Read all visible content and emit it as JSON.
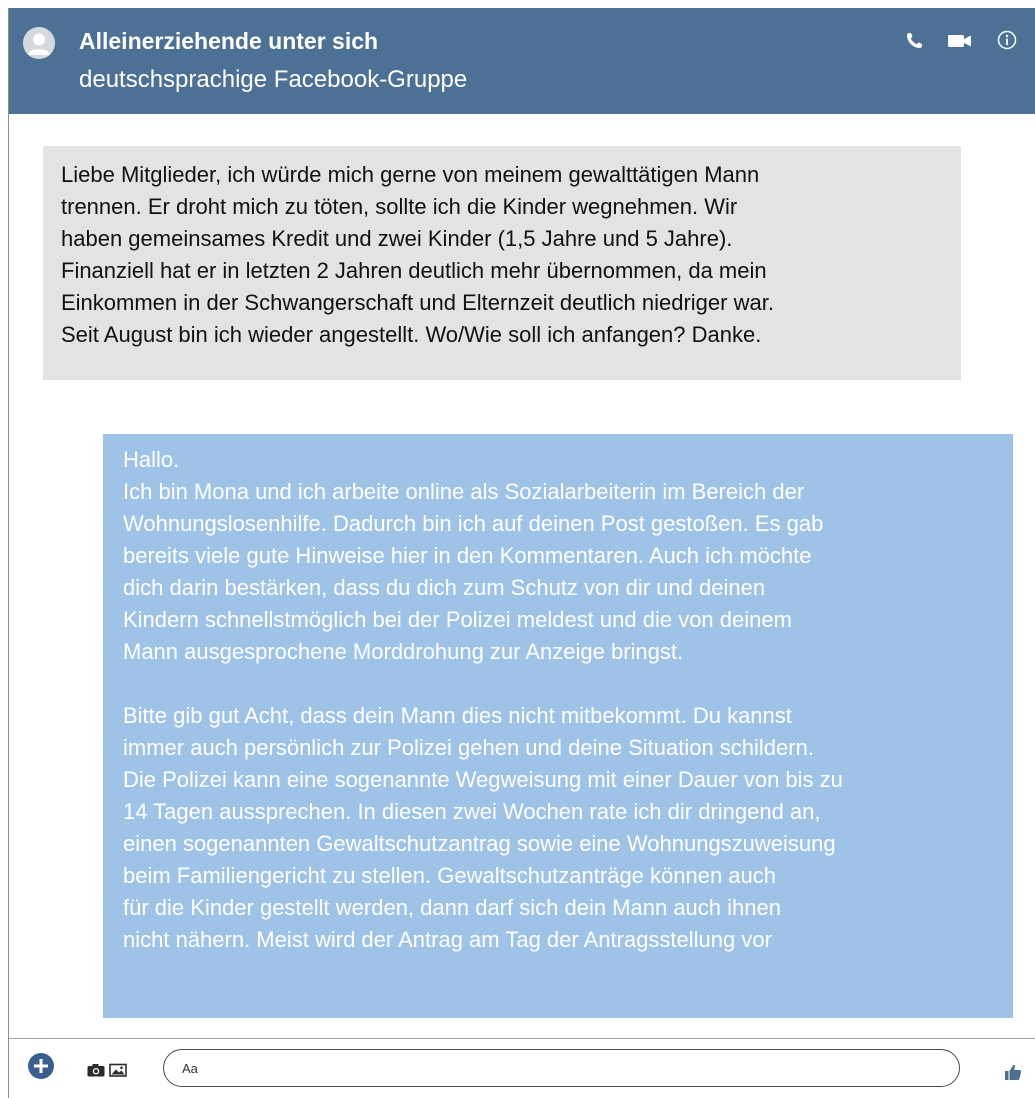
{
  "header": {
    "title": "Alleinerziehende unter sich",
    "subtitle": "deutschsprachige Facebook-Gruppe",
    "icons": [
      "phone-icon",
      "video-camera-icon",
      "info-icon"
    ]
  },
  "messages": {
    "incoming": "Liebe Mitglieder, ich würde mich gerne von meinem gewalttätigen Mann\ntrennen. Er droht mich zu töten, sollte ich die Kinder wegnehmen. Wir\nhaben gemeinsames Kredit und zwei Kinder (1,5 Jahre und 5 Jahre).\nFinanziell hat er in letzten 2 Jahren deutlich mehr übernommen, da mein\nEinkommen in der Schwangerschaft und Elternzeit deutlich niedriger war.\nSeit August bin ich wieder angestellt. Wo/Wie soll ich anfangen? Danke.",
    "outgoing": "Hallo.\nIch bin Mona und ich arbeite online als Sozialarbeiterin im Bereich der\nWohnungslosenhilfe. Dadurch bin ich auf deinen Post gestoßen. Es gab\nbereits viele gute Hinweise hier in den Kommentaren. Auch ich möchte\ndich darin bestärken, dass du dich zum Schutz von dir und deinen\nKindern schnellstmöglich bei der Polizei meldest und die von deinem\nMann ausgesprochene Morddrohung zur Anzeige bringst.\n\nBitte gib gut Acht, dass dein Mann dies nicht mitbekommt. Du kannst\nimmer auch persönlich zur Polizei gehen und deine Situation schildern.\nDie Polizei kann eine sogenannte Wegweisung mit einer Dauer von bis zu\n14 Tagen aussprechen. In diesen zwei Wochen rate ich dir dringend an,\neinen sogenannten Gewaltschutzantrag sowie eine Wohnungszuweisung\nbeim Familiengericht zu stellen. Gewaltschutzanträge können auch\nfür die Kinder gestellt werden, dann darf sich dein Mann auch ihnen\nnicht nähern. Meist wird der Antrag am Tag der Antragsstellung vor"
  },
  "composer": {
    "placeholder": "Aa",
    "icons": [
      "plus-icon",
      "camera-icon",
      "image-icon",
      "thumbs-up-icon"
    ]
  },
  "colors": {
    "header_bg": "#4d7095",
    "incoming_bubble": "#e3e3e3",
    "outgoing_bubble": "#9ec3e6",
    "accent": "#3a5f8f"
  }
}
